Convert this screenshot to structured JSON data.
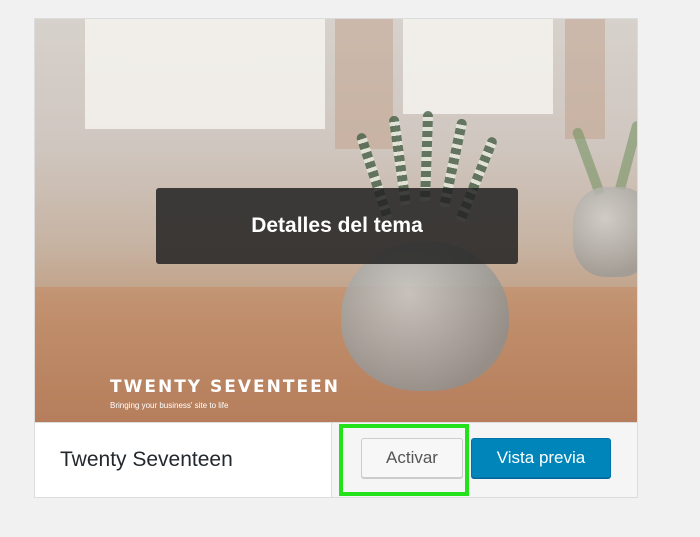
{
  "theme": {
    "name": "Twenty Seventeen",
    "screenshot": {
      "wordmark": "TWENTY SEVENTEEN",
      "tagline": "Bringing your business' site to life"
    }
  },
  "overlay": {
    "details_label": "Detalles del tema"
  },
  "actions": {
    "activate_label": "Activar",
    "preview_label": "Vista previa"
  },
  "colors": {
    "primary_button": "#0085ba",
    "highlight": "#24e21a",
    "page_background": "#f1f1f1"
  }
}
